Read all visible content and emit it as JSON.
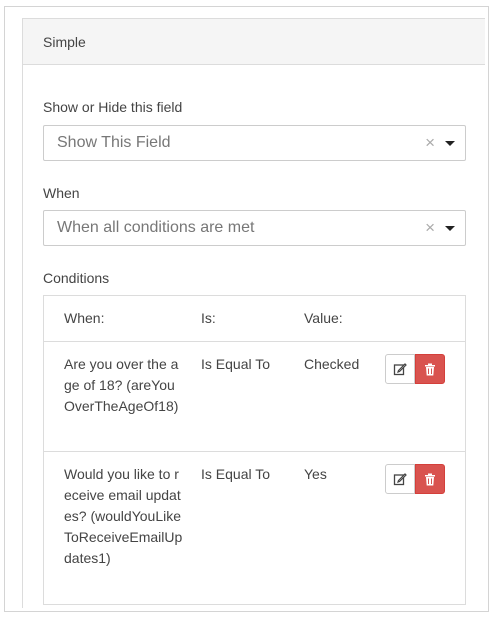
{
  "panel": {
    "title": "Simple"
  },
  "show_hide": {
    "label": "Show or Hide this field",
    "value": "Show This Field",
    "clear_glyph": "×"
  },
  "when": {
    "label": "When",
    "value": "When all conditions are met",
    "clear_glyph": "×"
  },
  "conditions": {
    "label": "Conditions",
    "headers": {
      "when": "When:",
      "is": "Is:",
      "value": "Value:"
    },
    "rows": [
      {
        "when": "Are you over the age of 18? (areYouOverTheAgeOf18)",
        "is": "Is Equal To",
        "value": "Checked"
      },
      {
        "when": "Would you like to receive email updates? (wouldYouLikeToReceiveEmailUpdates1)",
        "is": "Is Equal To",
        "value": "Yes"
      }
    ]
  },
  "icons": {
    "edit": "edit-icon",
    "delete": "trash-icon"
  },
  "colors": {
    "delete_button": "#d9534f",
    "heading_bg": "#f5f5f5"
  }
}
